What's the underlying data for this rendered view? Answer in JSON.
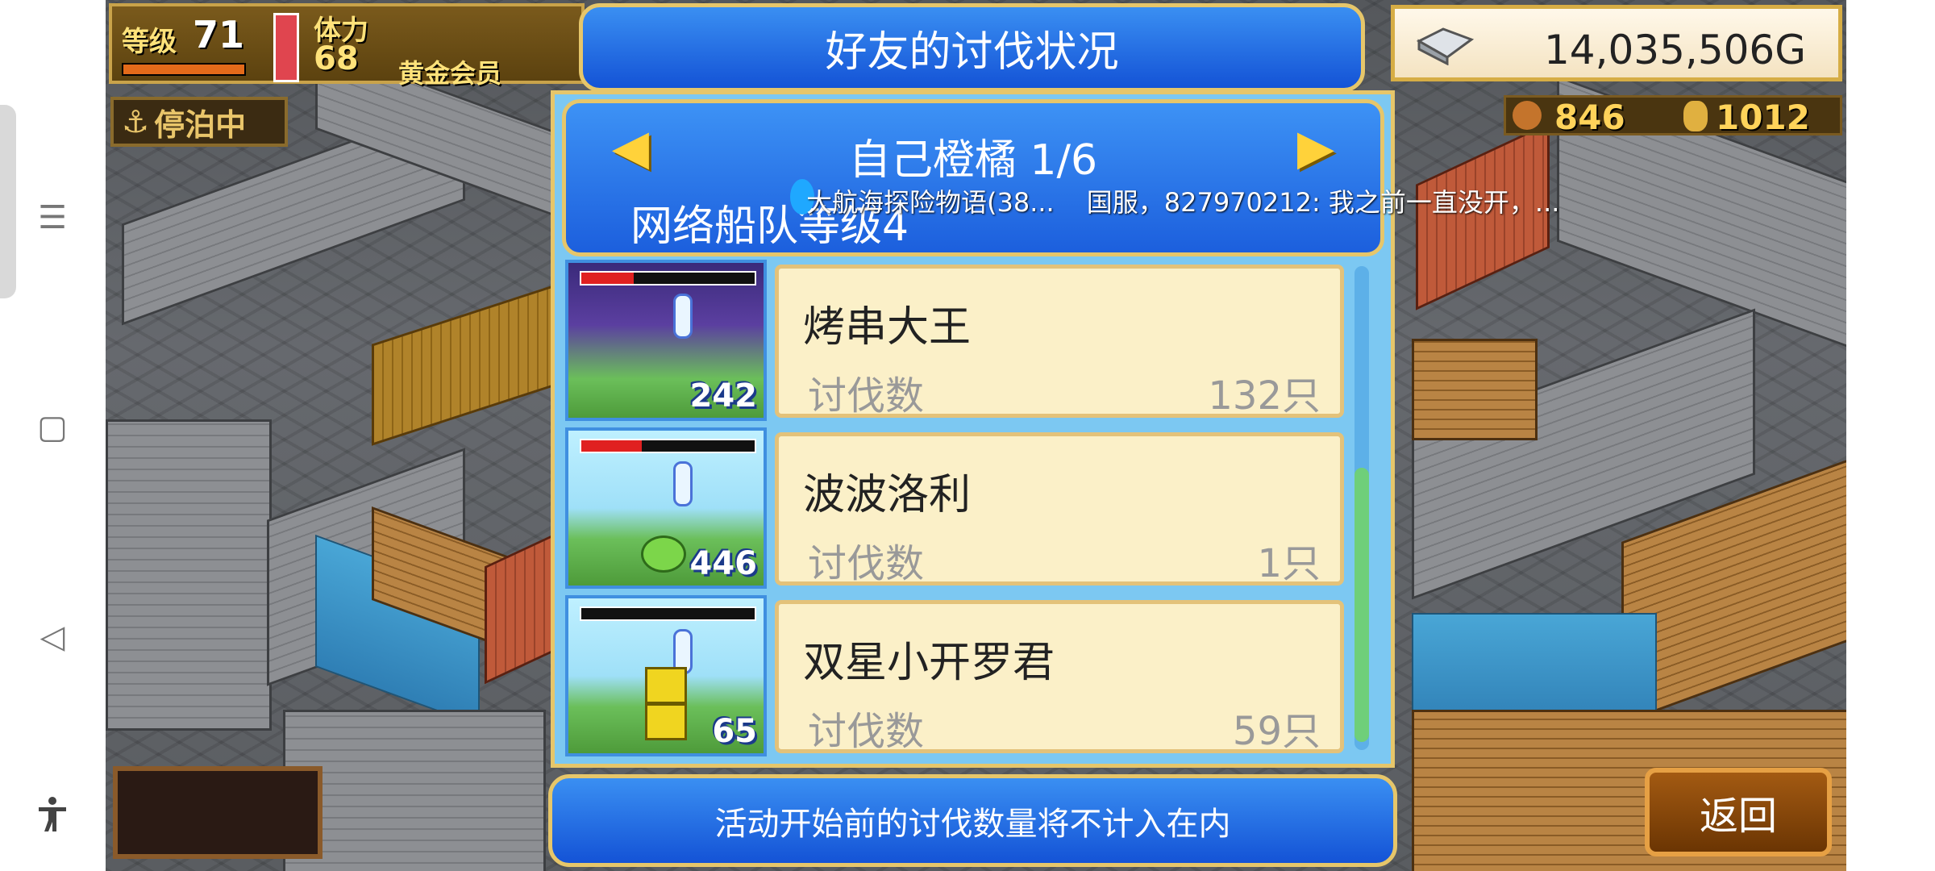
{
  "system_nav": {
    "menu_icon": "☰",
    "home_icon": "▢",
    "back_icon": "◁",
    "accessibility_icon": "accessibility-icon"
  },
  "hud": {
    "level_label": "等级",
    "level_value": "71",
    "stamina_label": "体力",
    "stamina_value": "68",
    "member_label": "黄金会员",
    "anchor_status": "停泊中",
    "gold": "14,035,506G",
    "resource_a": "846",
    "resource_b": "1012"
  },
  "dialog": {
    "title": "好友的讨伐状况",
    "player": "自己橙橘 1/6",
    "fleet_level": "网络船队等级4",
    "prev_arrow": "◀",
    "next_arrow": "▶",
    "footer_note": "活动开始前的讨伐数量将不计入在内",
    "back_button": "返回"
  },
  "chat": {
    "line1": "大航海探险物语(38...",
    "line2": "国服，827970212: 我之前一直没开，..."
  },
  "enemies": [
    {
      "name": "烤串大王",
      "kill_label": "讨伐数",
      "kill_count": "132只",
      "level": "242",
      "hp": 0.3
    },
    {
      "name": "波波洛利",
      "kill_label": "讨伐数",
      "kill_count": "1只",
      "level": "446",
      "hp": 0.35
    },
    {
      "name": "双星小开罗君",
      "kill_label": "讨伐数",
      "kill_count": "59只",
      "level": "65",
      "hp": 0.0
    }
  ],
  "colors": {
    "panel_blue": "#1c5fdd",
    "gold_border": "#e6c66a",
    "card_bg": "#fbf0c8"
  }
}
